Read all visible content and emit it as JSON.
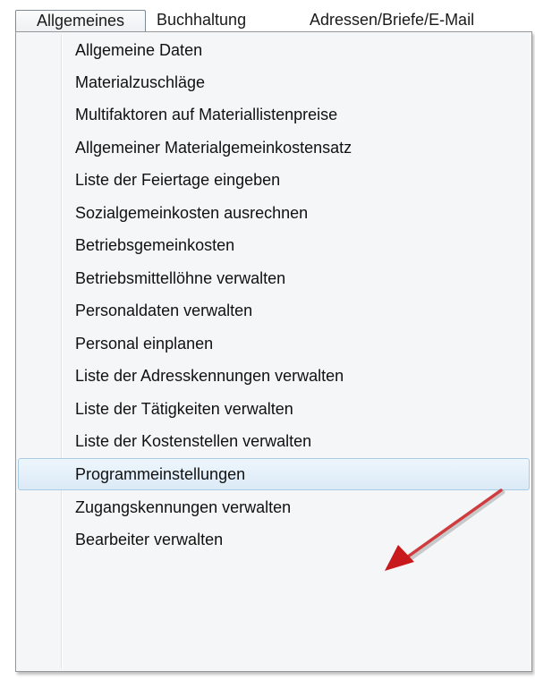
{
  "menubar": {
    "items": [
      "Allgemeines",
      "Buchhaltung",
      "Adressen/Briefe/E-Mail"
    ]
  },
  "dropdown": {
    "items": [
      "Allgemeine Daten",
      "Materialzuschläge",
      "Multifaktoren auf Materiallistenpreise",
      "Allgemeiner Materialgemeinkostensatz",
      "Liste der Feiertage eingeben",
      "Sozialgemeinkosten ausrechnen",
      "Betriebsgemeinkosten",
      "Betriebsmittellöhne verwalten",
      "Personaldaten verwalten",
      "Personal einplanen",
      "Liste der Adresskennungen verwalten",
      "Liste der Tätigkeiten verwalten",
      "Liste der Kostenstellen verwalten",
      "Programmeinstellungen",
      "Zugangskennungen verwalten",
      "Bearbeiter verwalten"
    ]
  },
  "colors": {
    "highlight": "#dbeaf6",
    "arrow": "#cc1f1f"
  },
  "icons": {
    "annotation": "red-arrow-icon"
  }
}
